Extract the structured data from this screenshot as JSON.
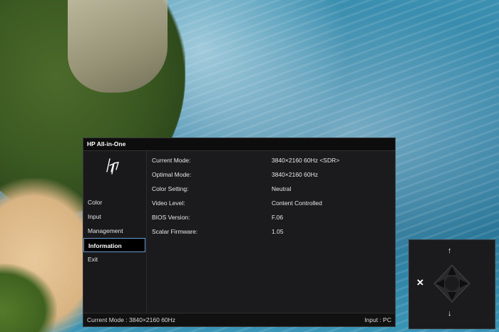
{
  "osd": {
    "title": "HP All-in-One",
    "menu": [
      {
        "label": "Color",
        "active": false
      },
      {
        "label": "Input",
        "active": false
      },
      {
        "label": "Management",
        "active": false
      },
      {
        "label": "Information",
        "active": true
      },
      {
        "label": "Exit",
        "active": false
      }
    ],
    "info": [
      {
        "key": "Current Mode:",
        "value": "3840×2160  60Hz <SDR>"
      },
      {
        "key": "Optimal Mode:",
        "value": "3840×2160  60Hz"
      },
      {
        "key": "Color Setting:",
        "value": "Neutral"
      },
      {
        "key": "Video Level:",
        "value": "Content Controlled"
      },
      {
        "key": "BIOS Version:",
        "value": "F.06"
      },
      {
        "key": "Scalar Firmware:",
        "value": "1.05"
      }
    ],
    "footer": {
      "current_mode": "Current Mode : 3840×2160  60Hz",
      "input": "Input : PC"
    }
  },
  "nav": {
    "icons": [
      "up-arrow-icon",
      "down-arrow-icon",
      "close-icon",
      "dpad-icon"
    ]
  },
  "colors": {
    "panel_bg": "#1b1b1d",
    "highlight_border": "#6a9ad0"
  }
}
